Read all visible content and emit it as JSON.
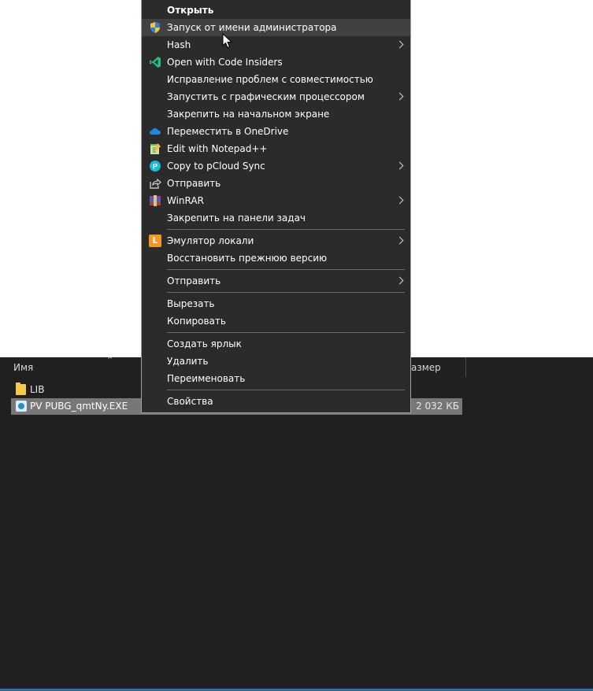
{
  "explorer": {
    "column_name": "Имя",
    "column_size": "азмер",
    "files": [
      {
        "name": "LIB",
        "type": "folder",
        "size": ""
      },
      {
        "name": "PV PUBG_qmtNy.EXE",
        "type": "exe",
        "size": "2 032 КБ",
        "selected": true
      }
    ]
  },
  "context_menu": {
    "items": [
      {
        "label": "Открыть",
        "bold": true
      },
      {
        "label": "Запуск от имени администратора",
        "icon": "uac-shield-icon",
        "hover": true
      },
      {
        "label": "Hash",
        "submenu": true
      },
      {
        "label": "Open with Code Insiders",
        "icon": "vscode-insiders-icon"
      },
      {
        "label": "Исправление проблем с совместимостью"
      },
      {
        "label": "Запустить с графическим процессором",
        "submenu": true
      },
      {
        "label": "Закрепить на начальном экране"
      },
      {
        "label": "Переместить в OneDrive",
        "icon": "onedrive-icon"
      },
      {
        "label": "Edit with Notepad++",
        "icon": "notepad-plus-plus-icon"
      },
      {
        "label": "Copy to pCloud Sync",
        "icon": "pcloud-icon",
        "submenu": true
      },
      {
        "label": "Отправить",
        "icon": "share-icon"
      },
      {
        "label": "WinRAR",
        "icon": "winrar-icon",
        "submenu": true
      },
      {
        "label": "Закрепить на панели задач"
      },
      {
        "label": "Эмулятор локали",
        "icon": "locale-emulator-icon",
        "icon_letter": "L",
        "submenu": true
      },
      {
        "label": "Восстановить прежнюю версию"
      },
      {
        "label": "Отправить",
        "submenu": true
      },
      {
        "label": "Вырезать"
      },
      {
        "label": "Копировать"
      },
      {
        "label": "Создать ярлык"
      },
      {
        "label": "Удалить"
      },
      {
        "label": "Переименовать"
      },
      {
        "label": "Свойства"
      }
    ]
  },
  "colors": {
    "menu_background": "#2b2b2b",
    "menu_hover": "#414141",
    "explorer_background": "#202020",
    "selection": "#777777"
  }
}
